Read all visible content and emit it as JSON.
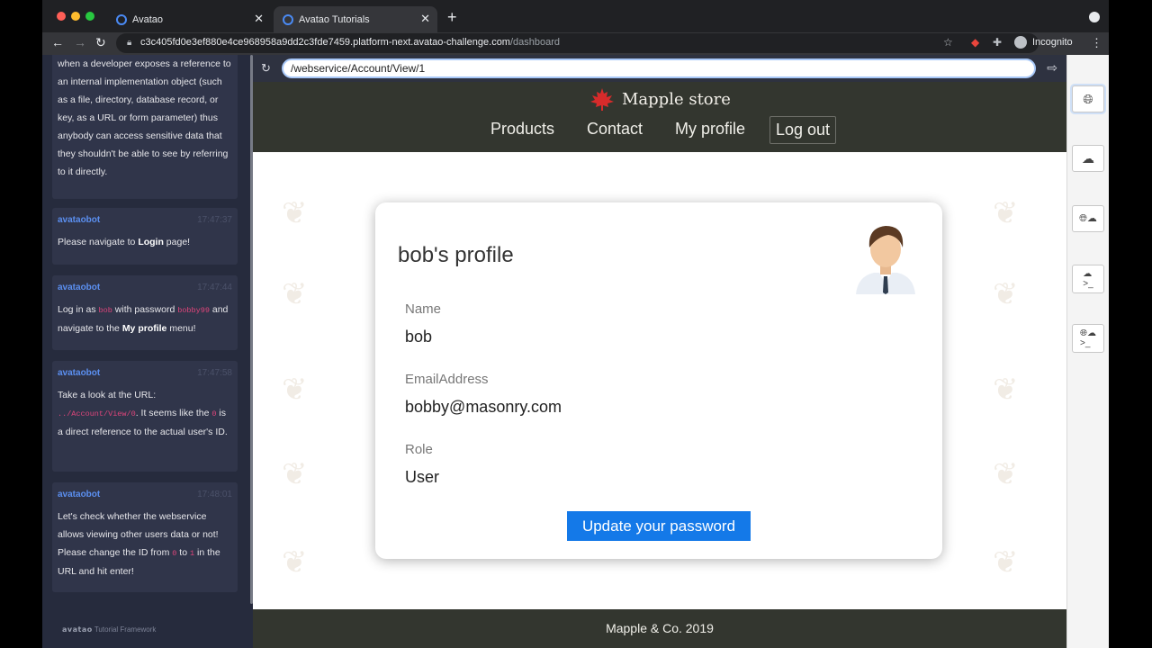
{
  "browser": {
    "tabs": [
      {
        "label": "Avatao",
        "active": false
      },
      {
        "label": "Avatao Tutorials",
        "active": true
      }
    ],
    "url_host": "c3c405fd0e3ef880e4ce968958a9dd2c3fde7459.platform-next.avatao-challenge.com",
    "url_path": "/dashboard",
    "profile_label": "Incognito",
    "extension_badge": "1"
  },
  "sidebar": {
    "intro_text": "when a developer exposes a reference to an internal implementation object (such as a file, directory, database record, or key, as a URL or form parameter) thus anybody can access sensitive data that they shouldn't be able to see by referring to it directly.",
    "messages": [
      {
        "author": "avataobot",
        "time": "17:47:37",
        "text_before": "Please navigate to ",
        "bold": "Login",
        "text_after": " page!"
      },
      {
        "author": "avataobot",
        "time": "17:47:44",
        "t1": "Log in as ",
        "code1": "bob",
        "t2": " with password ",
        "code2": "bobby99",
        "t3": " and navigate to the ",
        "bold": "My profile",
        "t4": " menu!"
      },
      {
        "author": "avataobot",
        "time": "17:47:58",
        "t1": "Take a look at the URL: ",
        "code1": "../Account/View/0",
        "t2": ". It seems like the ",
        "code2": "0",
        "t3": " is a direct reference to the actual user's ID."
      },
      {
        "author": "avataobot",
        "time": "17:48:01",
        "t1": "Let's check whether the webservice allows viewing other users data or not! Please change the ID from ",
        "code1": "0",
        "t2": " to ",
        "code2": "1",
        "t3": " in the URL and hit enter!"
      }
    ],
    "footer_brand": "avatao",
    "footer_text": "Tutorial Framework"
  },
  "inner_browser": {
    "url_value": "/webservice/Account/View/1"
  },
  "site": {
    "brand": "Mapple store",
    "nav": [
      "Products",
      "Contact",
      "My profile",
      "Log out"
    ],
    "footer": "Mapple & Co. 2019"
  },
  "profile": {
    "title": "bob's profile",
    "fields": [
      {
        "label": "Name",
        "value": "bob"
      },
      {
        "label": "EmailAddress",
        "value": "bobby@masonry.com"
      },
      {
        "label": "Role",
        "value": "User"
      }
    ],
    "update_button": "Update your password"
  },
  "rail": {
    "buttons": [
      "globe-icon",
      "cloud-code-icon",
      "globe-cloud-icon",
      "cloud-terminal-icon",
      "globe-terminal-cloud-icon"
    ]
  },
  "colors": {
    "accent": "#1479e8",
    "header_bg": "#33362f",
    "sidebar_bg": "#262b3d",
    "bot_name": "#5b8ff0",
    "code_pink": "#e0457b"
  }
}
